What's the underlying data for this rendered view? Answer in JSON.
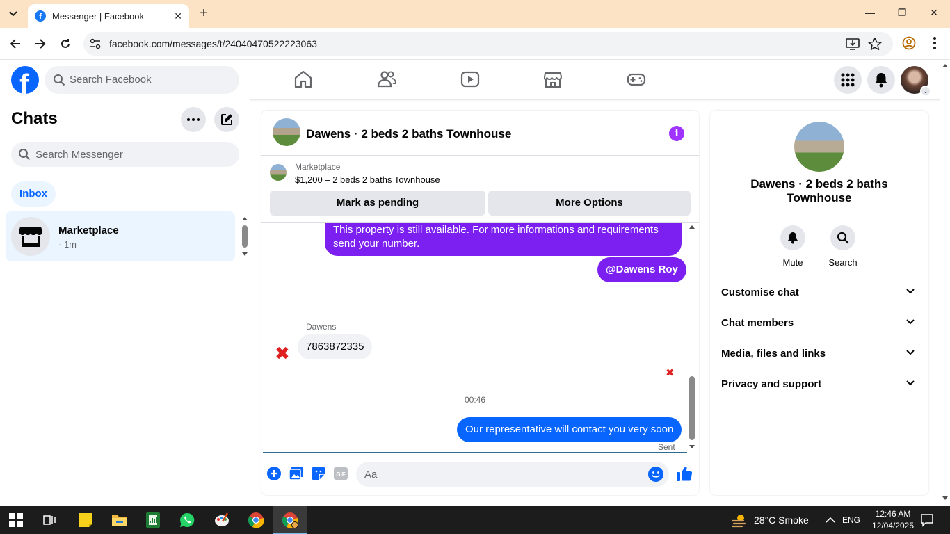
{
  "browser": {
    "tab_title": "Messenger | Facebook",
    "url": "facebook.com/messages/t/24040470522223063"
  },
  "header": {
    "search_placeholder": "Search Facebook"
  },
  "chats": {
    "title": "Chats",
    "search_placeholder": "Search Messenger",
    "filter_label": "Inbox",
    "items": [
      {
        "name": "Marketplace",
        "meta": "· 1m"
      }
    ]
  },
  "conversation": {
    "title": "Dawens · 2 beds 2 baths Townhouse",
    "marketplace_label": "Marketplace",
    "listing": "$1,200 – 2 beds 2 baths Townhouse",
    "btn_pending": "Mark as pending",
    "btn_options": "More Options",
    "messages": {
      "out1": "This property is still available. For more informations and requirements send your number.",
      "out2": "@Dawens Roy",
      "sender": "Dawens",
      "in1": "7863872335",
      "timestamp": "00:46",
      "out3": "Our representative will contact you very soon",
      "status": "Sent"
    },
    "composer_placeholder": "Aa"
  },
  "info_panel": {
    "name": "Dawens · 2 beds 2 baths Townhouse",
    "actions": [
      "Mute",
      "Search"
    ],
    "sections": [
      "Customise chat",
      "Chat members",
      "Media, files and links",
      "Privacy and support"
    ]
  },
  "taskbar": {
    "weather": "28°C  Smoke",
    "language": "ENG",
    "time": "12:46 AM",
    "date": "12/04/2025"
  },
  "colors": {
    "brand_blue": "#0866ff",
    "outgoing_purple": "#7b20f0",
    "tab_strip": "#fde3c5"
  }
}
